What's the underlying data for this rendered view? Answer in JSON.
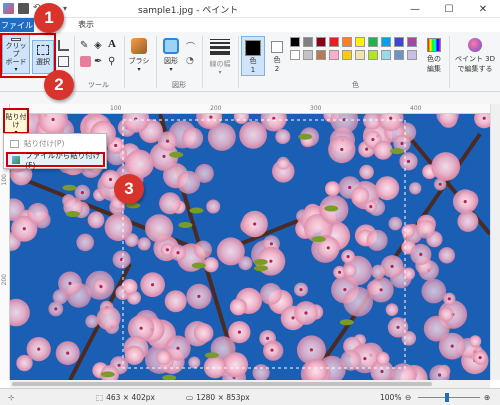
{
  "window": {
    "title": "sample1.jpg - ペイント",
    "minimize": "—",
    "maximize": "☐",
    "close": "✕"
  },
  "tabs": {
    "file": "ファイル",
    "view": "表示"
  },
  "ribbon": {
    "clipboard_label": "クリップボード",
    "clipboard_btn_line1": "クリップ",
    "clipboard_btn_line2": "ボード",
    "select_label": "選択",
    "tools_group": "ツール",
    "brush_label": "ブラシ",
    "shapes_label": "図形",
    "shapes_group": "図形",
    "line_width_label": "線の幅",
    "color1_label": "色",
    "color1_num": "1",
    "color2_label": "色",
    "color2_num": "2",
    "colors_group": "色",
    "edit_colors_line1": "色の",
    "edit_colors_line2": "編集",
    "paint3d_line1": "ペイント 3D",
    "paint3d_line2": "で編集する"
  },
  "palette": [
    "#000000",
    "#7f7f7f",
    "#880015",
    "#ed1c24",
    "#ff7f27",
    "#fff200",
    "#22b14c",
    "#00a2e8",
    "#3f48cc",
    "#a349a4",
    "#ffffff",
    "#c3c3c3",
    "#b97a57",
    "#ffaec9",
    "#ffc90e",
    "#efe4b0",
    "#b5e61d",
    "#99d9ea",
    "#7092be",
    "#c8bfe7"
  ],
  "paste": {
    "button_line1": "貼り付け",
    "menu_item1": "貼り付け(P)",
    "menu_item2": "ファイルから貼り付け(F)"
  },
  "ruler": {
    "h_ticks": [
      "100",
      "200",
      "300",
      "400"
    ],
    "v_ticks": [
      "100",
      "200"
    ]
  },
  "status": {
    "selection_size": "463 × 402px",
    "image_size": "1280 × 853px",
    "zoom": "100%",
    "zoom_minus": "⊖",
    "zoom_plus": "⊕"
  },
  "callouts": [
    "1",
    "2",
    "3"
  ],
  "colors": {
    "accent": "#1e6fc4",
    "callout": "#d8342b",
    "highlight_frame": "#d20000"
  }
}
